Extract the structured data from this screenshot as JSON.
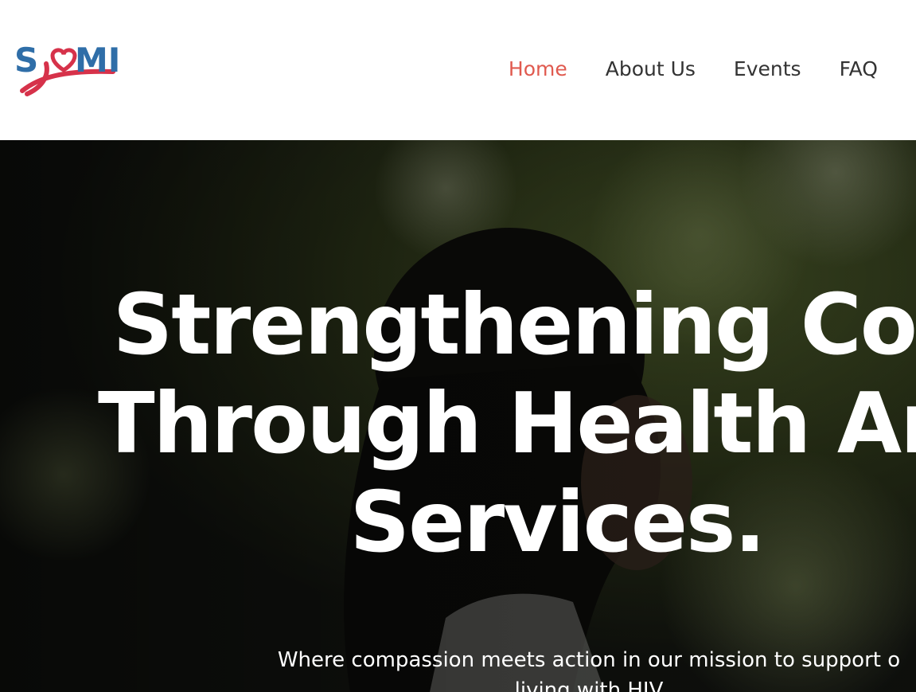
{
  "brand": {
    "logo_text": "SOMI",
    "logo_colors": {
      "blue": "#2f6ea8",
      "red": "#d6324a",
      "pink": "#e6768a"
    }
  },
  "nav": {
    "items": [
      {
        "label": "Home",
        "active": true
      },
      {
        "label": "About Us",
        "active": false
      },
      {
        "label": "Events",
        "active": false
      },
      {
        "label": "FAQ",
        "active": false
      }
    ],
    "active_color": "#e05a4f",
    "text_color": "#333333"
  },
  "hero": {
    "title_lines": [
      "Strengthening Com",
      "Through Health And",
      "Services."
    ],
    "subtitle_lines": [
      "Where compassion meets action in our mission to support o",
      "living with HIV"
    ],
    "overlay_color": "#000000"
  }
}
